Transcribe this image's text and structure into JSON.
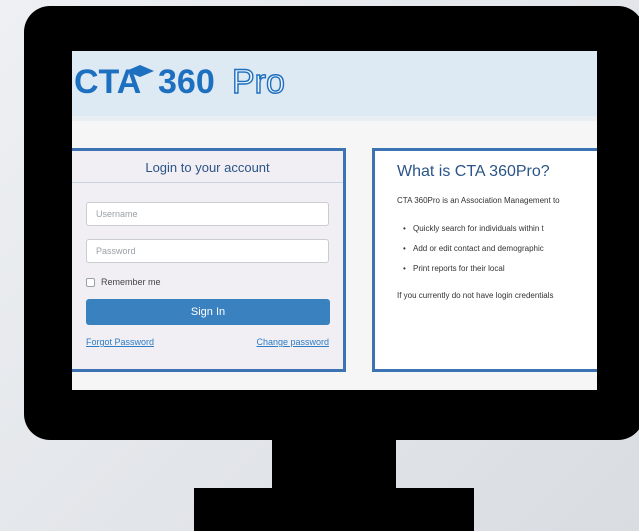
{
  "brand": {
    "logo_text_cta": "CTA",
    "logo_text_360": "360",
    "logo_text_pro": "Pro"
  },
  "login": {
    "title": "Login to your account",
    "username_placeholder": "Username",
    "password_placeholder": "Password",
    "remember_label": "Remember me",
    "signin_label": "Sign In",
    "forgot_label": "Forgot Password",
    "change_label": "Change password"
  },
  "info": {
    "title": "What is CTA 360Pro?",
    "intro": "CTA 360Pro is an Association Management to",
    "bullets": [
      "Quickly search for individuals within t",
      "Add or edit contact and demographic",
      "Print reports for their local"
    ],
    "footer": "If you currently do not have login credentials"
  },
  "colors": {
    "accent": "#3a81bf",
    "border": "#3c74b3",
    "header_bg": "#dde9f3"
  }
}
